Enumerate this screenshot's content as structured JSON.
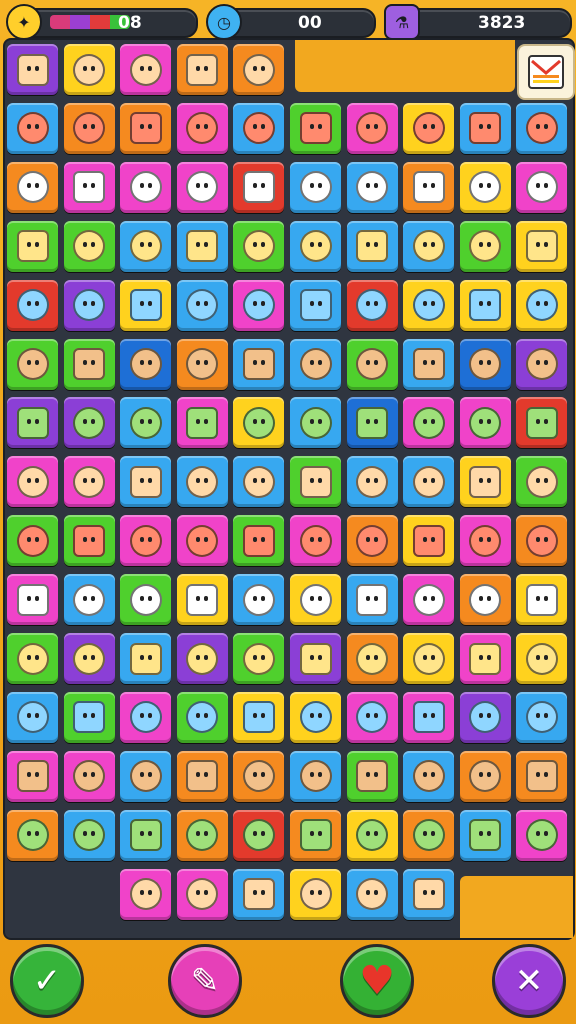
{
  "hud": {
    "level_value": "08",
    "moves_value": "00",
    "score_value": "3823",
    "level_icon": "trophy-icon",
    "moves_icon": "clock-icon",
    "score_icon": "potion-icon",
    "meter_colors": [
      "#d93b7a",
      "#9b3fd1",
      "#e23b3b",
      "#39c23a"
    ]
  },
  "board": {
    "cols": 10,
    "palette": {
      "O": "#f58a1f",
      "M": "#f043c9",
      "Y": "#ffd21e",
      "B": "#37a8f0",
      "G": "#4fd02d",
      "P": "#8b3fd6",
      "R": "#e33a2c",
      "D": "#1e6fd6",
      "L": "#c6f04a"
    },
    "rows": [
      "PYMOO.....",
      "BOOMBGMYBB",
      "OMMMRBBOYM",
      "GGBBGBBBGY",
      "RPYBMBRYYY",
      "GGDOBBGBDP",
      "PPBMYBDMMR",
      "MMBBBGBBYG",
      "GGMMGMOYMO",
      "MBGYBYBMOY",
      "GPBPGPOYMY",
      "BGMGYYMMPB",
      "MMBOOBGBOO",
      "OBBOROYOBM",
      "..MMBYBB.."
    ]
  },
  "menu_button_icon": "menu-card-icon",
  "bottom_buttons": [
    {
      "name": "confirm-button",
      "icon": "check-icon",
      "color": "#36b43a",
      "glyph": "✓"
    },
    {
      "name": "hint-button",
      "icon": "wand-icon",
      "color": "#e640b8",
      "glyph": "✎"
    },
    {
      "name": "lives-button",
      "icon": "heart-icon",
      "color": "#34b134",
      "glyph": "♥"
    },
    {
      "name": "close-button",
      "icon": "close-icon",
      "color": "#9a3fd8",
      "glyph": "✕"
    }
  ]
}
